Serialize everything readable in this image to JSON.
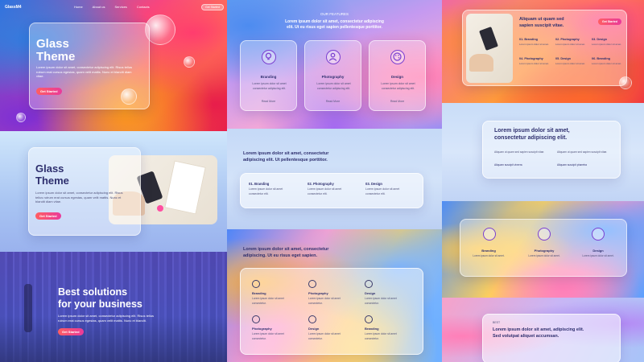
{
  "nav": {
    "logo": "GlassM4",
    "links": [
      "Home",
      "About us",
      "Services",
      "Contacts"
    ],
    "cta": "Get Started"
  },
  "hero": {
    "title_line1": "Glass",
    "title_line2": "Theme",
    "body": "Lorem ipsum dolor sit amet, consectetur adipiscing elit. Risus tellus rutrum erat cursus egestas, quam velit mattis. Nunc et blandit diam vitae.",
    "button": "Get Started"
  },
  "hero2": {
    "title_line1": "Glass",
    "title_line2": "Theme",
    "body": "Lorem ipsum dolor sit amet, consectetur adipiscing elit. Risus tellus rutrum erat cursus egestas, quam velit mattis. Nunc et blandit diam vitae.",
    "button": "Get Started"
  },
  "business": {
    "title_line1": "Best solutions",
    "title_line2": "for your business",
    "body": "Lorem ipsum dolor sit amet, consectetur adipiscing elit. Risus tellus rutrum erat cursus egestas, quam velit mattis. Nunc et blandit.",
    "button": "Get Started"
  },
  "features": {
    "eyebrow": "OUR FEATURES",
    "title_line1": "Lorem ipsum dolor sit amet, consectetur adipiscing",
    "title_line2": "elit. Ut eu risus eget sapien pellentesque porttitor.",
    "cards": [
      {
        "label": "Branding",
        "text": "Lorem ipsum dolor sit amet consectetur adipiscing elit.",
        "link": "Read More"
      },
      {
        "label": "Photography",
        "text": "Lorem ipsum dolor sit amet consectetur adipiscing elit.",
        "link": "Read More"
      },
      {
        "label": "Design",
        "text": "Lorem ipsum dolor sit amet consectetur adipiscing elit.",
        "link": "Read More"
      }
    ]
  },
  "steps": {
    "title_line1": "Lorem ipsum dolor sit amet, consectetur",
    "title_line2": "adipiscing elit. Ut pellentesque porttitor.",
    "items": [
      {
        "label": "01. Branding",
        "text": "Lorem ipsum dolor sit amet consectetur elit."
      },
      {
        "label": "02. Photography",
        "text": "Lorem ipsum dolor sit amet consectetur elit."
      },
      {
        "label": "03. Design",
        "text": "Lorem ipsum dolor sit amet consectetur elit."
      }
    ]
  },
  "grid6": {
    "title_line1": "Lorem ipsum dolor sit amet, consectetur",
    "title_line2": "adipiscing. Ut eu risus eget sapien.",
    "items": [
      {
        "label": "Branding",
        "text": "Lorem ipsum dolor sit amet consectetur."
      },
      {
        "label": "Photography",
        "text": "Lorem ipsum dolor sit amet consectetur."
      },
      {
        "label": "Design",
        "text": "Lorem ipsum dolor sit amet consectetur."
      },
      {
        "label": "Photography",
        "text": "Lorem ipsum dolor sit amet consectetur."
      },
      {
        "label": "Design",
        "text": "Lorem ipsum dolor sit amet consectetur."
      },
      {
        "label": "Branding",
        "text": "Lorem ipsum dolor sit amet consectetur."
      }
    ]
  },
  "right_top": {
    "title_line1": "Aliquam ut quam sed",
    "title_line2": "sapien suscipit vitae.",
    "button": "Get Started",
    "items": [
      "01. Branding",
      "02. Photography",
      "03. Design",
      "04. Photography",
      "05. Design",
      "06. Branding"
    ],
    "item_text": "Lorem ipsum dolor sit amet."
  },
  "right_mid": {
    "title_line1": "Lorem ipsum dolor sit amet,",
    "title_line2": "consectetur adipiscing elit.",
    "col1_text": "Aliquam ut quam sed sapien suscipit vitae.",
    "col1_link": "Aliquam suscipit viverra",
    "col2_text": "Aliquam ut quam sed sapien suscipit vitae.",
    "col2_link": "Aliquam suscipit pharetra"
  },
  "right_icons": {
    "items": [
      {
        "label": "Branding",
        "text": "Lorem ipsum dolor sit amet."
      },
      {
        "label": "Photography",
        "text": "Lorem ipsum dolor sit amet."
      },
      {
        "label": "Design",
        "text": "Lorem ipsum dolor sit amet."
      }
    ]
  },
  "right_bottom": {
    "eyebrow": "BEST",
    "title_line1": "Lorem ipsum dolor sit amet, adipiscing elit.",
    "title_line2": "Sed volutpat aliquet accumsan."
  },
  "colors": {
    "accent_gradient_start": "#ff5e62",
    "accent_gradient_end": "#e93a9a",
    "dark_text": "#2e2f6e",
    "icon_purple": "#7a3fd0"
  }
}
